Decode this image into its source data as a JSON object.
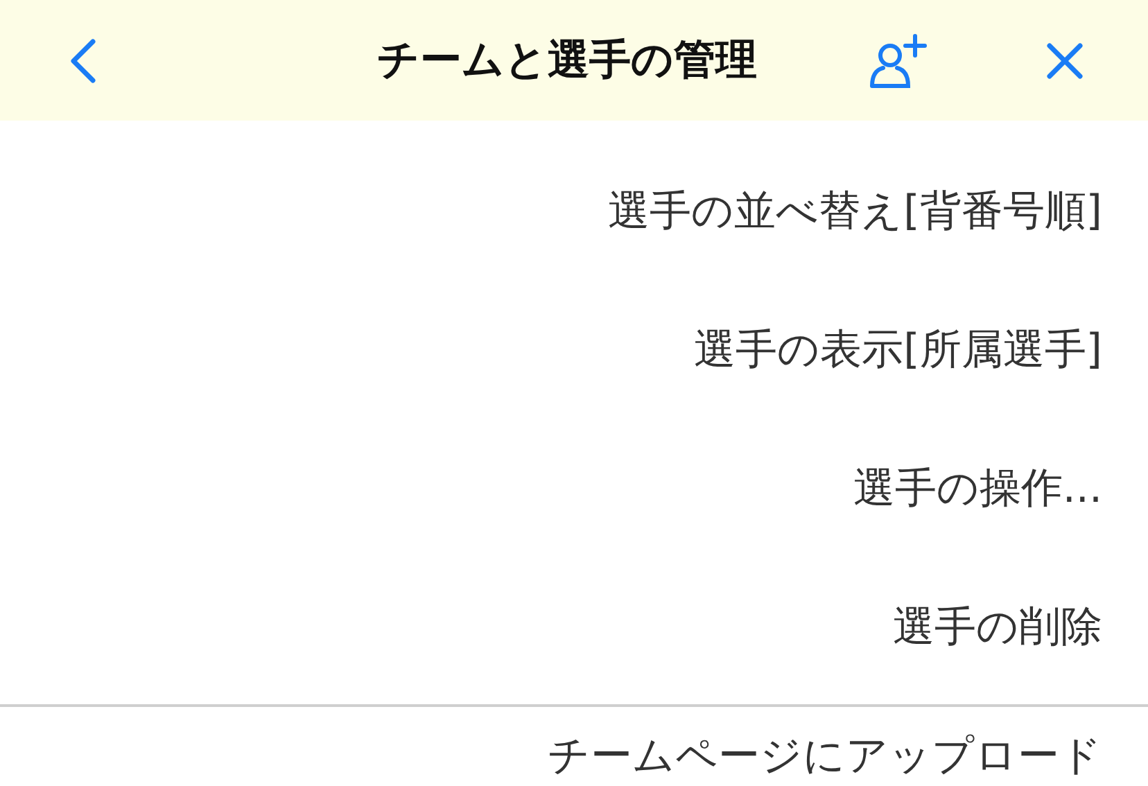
{
  "header": {
    "title": "チームと選手の管理"
  },
  "menu_items": [
    {
      "label": "選手の並べ替え[背番号順]"
    },
    {
      "label": "選手の表示[所属選手]"
    },
    {
      "label": "選手の操作..."
    },
    {
      "label": "選手の削除"
    }
  ],
  "menu_items_2": [
    {
      "label": "チームページにアップロード"
    }
  ]
}
